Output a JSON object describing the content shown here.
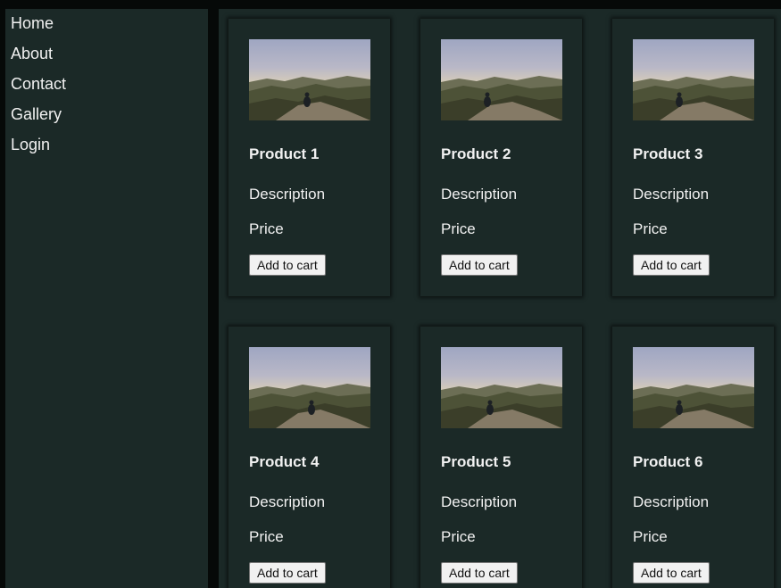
{
  "nav": {
    "items": [
      {
        "label": "Home"
      },
      {
        "label": "About"
      },
      {
        "label": "Contact"
      },
      {
        "label": "Gallery"
      },
      {
        "label": "Login"
      }
    ]
  },
  "products": [
    {
      "title": "Product 1",
      "description": "Description",
      "price": "Price",
      "button": "Add to cart"
    },
    {
      "title": "Product 2",
      "description": "Description",
      "price": "Price",
      "button": "Add to cart"
    },
    {
      "title": "Product 3",
      "description": "Description",
      "price": "Price",
      "button": "Add to cart"
    },
    {
      "title": "Product 4",
      "description": "Description",
      "price": "Price",
      "button": "Add to cart"
    },
    {
      "title": "Product 5",
      "description": "Description",
      "price": "Price",
      "button": "Add to cart"
    },
    {
      "title": "Product 6",
      "description": "Description",
      "price": "Price",
      "button": "Add to cart"
    }
  ],
  "colors": {
    "background": "#060908",
    "panel": "#1b2927",
    "text": "#f1f1f1",
    "button": "#f1f1f1"
  }
}
